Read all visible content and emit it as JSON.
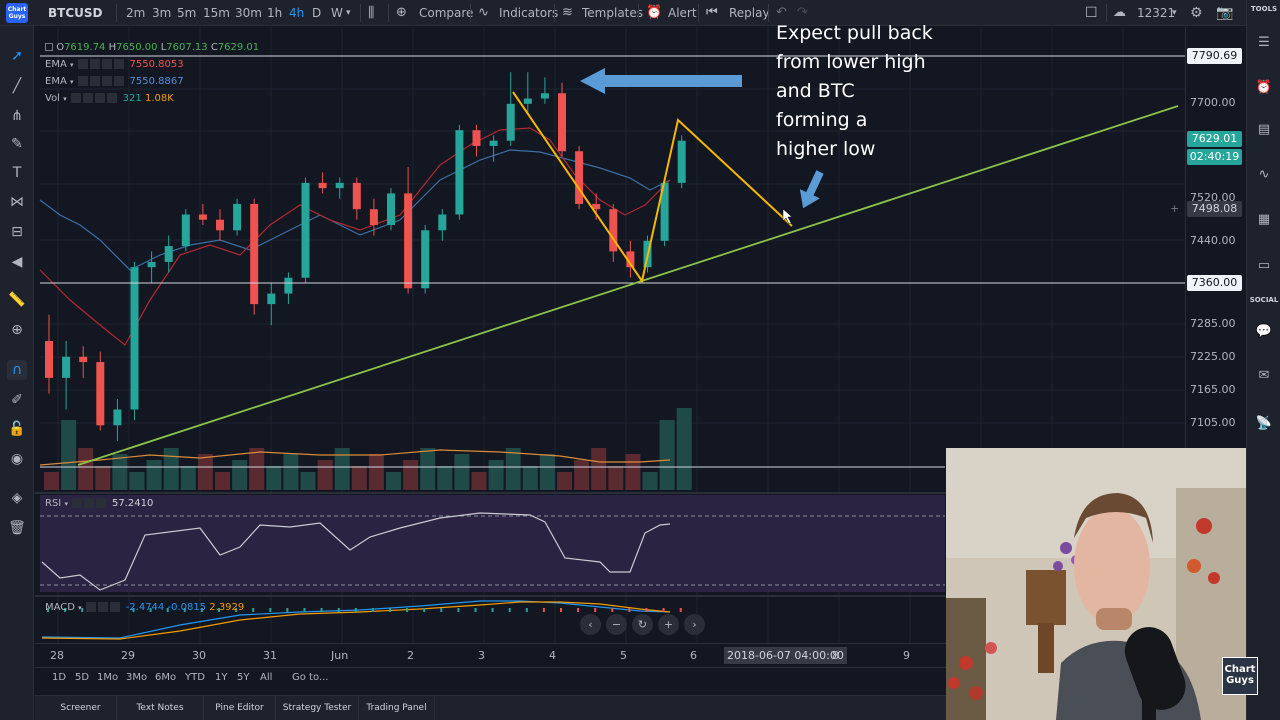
{
  "toolbar": {
    "symbol": "BTCUSD",
    "logo_text": "Chart Guys",
    "timeframes": [
      "2m",
      "3m",
      "5m",
      "15m",
      "30m",
      "1h",
      "4h",
      "D",
      "W"
    ],
    "active_timeframe": "4h",
    "compare_label": "Compare",
    "indicators_label": "Indicators",
    "templates_label": "Templates",
    "alert_label": "Alert",
    "replay_label": "Replay",
    "counter": "12321"
  },
  "legend": {
    "ohlc": {
      "o_key": "O",
      "o": "7619.74",
      "h_key": "H",
      "h": "7650.00",
      "l_key": "L",
      "l": "7607.13",
      "c_key": "C",
      "c": "7629.01"
    },
    "ema1": {
      "label": "EMA",
      "value": "7550.8053"
    },
    "ema2": {
      "label": "EMA",
      "value": "7550.8867"
    },
    "vol": {
      "label": "Vol",
      "value1": "321",
      "value2": "1.08K"
    },
    "rsi": {
      "label": "RSI",
      "value": "57.2410"
    },
    "macd": {
      "label": "MACD",
      "v1": "-2.4744",
      "v2": "-0.0815",
      "v3": "2.3929"
    }
  },
  "price_scale": {
    "labels": [
      "7700.00",
      "7520.00",
      "7440.00",
      "7285.00",
      "7225.00",
      "7165.00",
      "7105.00"
    ],
    "badge_top": "7790.69",
    "badge_last": "7629.01",
    "badge_countdown": "02:40:19",
    "badge_cursor": "7498.08",
    "badge_line": "7360.00"
  },
  "time_axis": {
    "labels": [
      "28",
      "29",
      "30",
      "31",
      "Jun",
      "2",
      "3",
      "4",
      "5",
      "6",
      "8",
      "9"
    ],
    "cursor_badge": "2018-06-07 04:00:00"
  },
  "range_bar": {
    "ranges": [
      "1D",
      "5D",
      "1Mo",
      "3Mo",
      "6Mo",
      "YTD",
      "1Y",
      "5Y",
      "All"
    ],
    "goto": "Go to..."
  },
  "bottom_tabs": [
    "Screener",
    "Text Notes",
    "Pine Editor",
    "Strategy Tester",
    "Trading Panel"
  ],
  "right_bar": {
    "tools_label": "TOOLS",
    "social_label": "SOCIAL"
  },
  "annotation": {
    "line1": "Expect pull back",
    "line2": "from lower high",
    "line3": "and BTC",
    "line4": "forming a",
    "line5": "higher low"
  },
  "webcam": {
    "logo": "Chart Guys"
  },
  "chart_data": {
    "type": "candlestick",
    "symbol": "BTCUSD",
    "interval": "4h",
    "ylim": [
      7040,
      7800
    ],
    "candles_approx": [
      [
        7250,
        7300,
        7150,
        7180
      ],
      [
        7180,
        7250,
        7120,
        7220
      ],
      [
        7220,
        7240,
        7180,
        7210
      ],
      [
        7210,
        7230,
        7080,
        7090
      ],
      [
        7090,
        7140,
        7060,
        7120
      ],
      [
        7120,
        7400,
        7100,
        7390
      ],
      [
        7390,
        7420,
        7360,
        7400
      ],
      [
        7400,
        7450,
        7380,
        7430
      ],
      [
        7430,
        7500,
        7420,
        7490
      ],
      [
        7490,
        7510,
        7470,
        7480
      ],
      [
        7480,
        7500,
        7440,
        7460
      ],
      [
        7460,
        7520,
        7450,
        7510
      ],
      [
        7510,
        7520,
        7300,
        7320
      ],
      [
        7320,
        7360,
        7280,
        7340
      ],
      [
        7340,
        7380,
        7320,
        7370
      ],
      [
        7370,
        7560,
        7360,
        7550
      ],
      [
        7550,
        7570,
        7530,
        7540
      ],
      [
        7540,
        7560,
        7520,
        7550
      ],
      [
        7550,
        7560,
        7480,
        7500
      ],
      [
        7500,
        7520,
        7450,
        7470
      ],
      [
        7470,
        7540,
        7460,
        7530
      ],
      [
        7530,
        7580,
        7340,
        7350
      ],
      [
        7350,
        7470,
        7340,
        7460
      ],
      [
        7460,
        7500,
        7440,
        7490
      ],
      [
        7490,
        7660,
        7480,
        7650
      ],
      [
        7650,
        7660,
        7600,
        7620
      ],
      [
        7620,
        7640,
        7590,
        7630
      ],
      [
        7630,
        7760,
        7620,
        7700
      ],
      [
        7700,
        7760,
        7680,
        7710
      ],
      [
        7710,
        7750,
        7700,
        7720
      ],
      [
        7720,
        7740,
        7600,
        7610
      ],
      [
        7610,
        7620,
        7500,
        7510
      ],
      [
        7510,
        7530,
        7480,
        7500
      ],
      [
        7500,
        7510,
        7400,
        7420
      ],
      [
        7420,
        7440,
        7370,
        7390
      ],
      [
        7390,
        7450,
        7380,
        7440
      ],
      [
        7440,
        7560,
        7430,
        7550
      ],
      [
        7550,
        7640,
        7540,
        7630
      ]
    ],
    "horizontal_lines": [
      7790.69,
      7360.0
    ],
    "trendline_label": "",
    "rsi_last": 57.241
  }
}
